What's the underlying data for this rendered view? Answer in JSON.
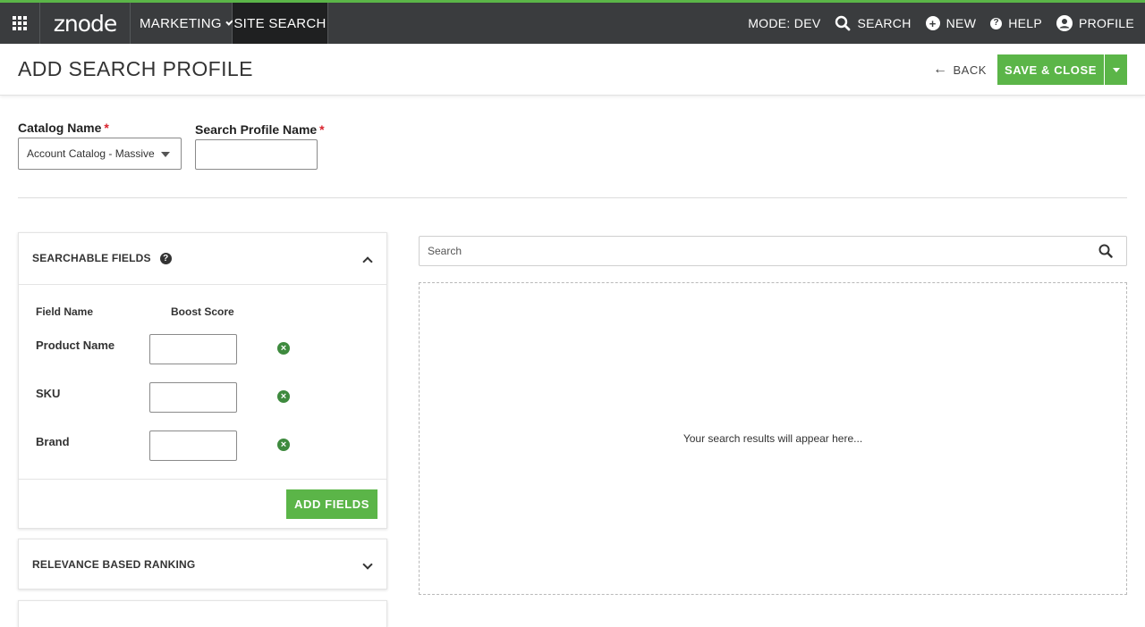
{
  "topnav": {
    "logo": "znode",
    "marketing": "MARKETING",
    "site_search": "SITE SEARCH",
    "mode": "MODE: DEV",
    "search": "SEARCH",
    "new": "NEW",
    "help": "HELP",
    "profile": "PROFILE"
  },
  "header": {
    "title": "ADD SEARCH PROFILE",
    "back": "BACK",
    "save_close": "SAVE & CLOSE"
  },
  "form": {
    "catalog_label": "Catalog Name",
    "catalog_value": "Account Catalog - Massive",
    "profile_label": "Search Profile Name",
    "profile_value": "",
    "required_mark": "*"
  },
  "searchable_fields": {
    "title": "SEARCHABLE FIELDS",
    "col_field": "Field Name",
    "col_boost": "Boost Score",
    "rows": [
      {
        "name": "Product Name",
        "boost": ""
      },
      {
        "name": "SKU",
        "boost": ""
      },
      {
        "name": "Brand",
        "boost": ""
      }
    ],
    "add_button": "ADD FIELDS"
  },
  "relevance": {
    "title": "RELEVANCE BASED RANKING"
  },
  "search": {
    "placeholder": "Search",
    "results_empty": "Your search results will appear here..."
  },
  "colors": {
    "accent": "#5bb548",
    "nav_bg": "#3a3c3e",
    "required": "#d9232d"
  }
}
